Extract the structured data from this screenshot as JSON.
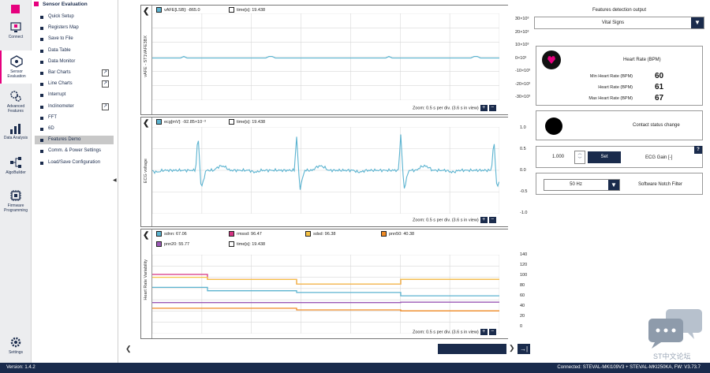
{
  "sidebar": {
    "items": [
      {
        "label": "Connect",
        "icon": "connect-icon"
      },
      {
        "label": "Sensor Evaluation",
        "icon": "sensor-evaluation-icon",
        "active": true
      },
      {
        "label": "Advanced Features",
        "icon": "advanced-features-icon"
      },
      {
        "label": "Data Analysis",
        "icon": "data-analysis-icon"
      },
      {
        "label": "AlgoBuilder",
        "icon": "algobuilder-icon"
      },
      {
        "label": "Firmware Programming",
        "icon": "firmware-programming-icon"
      },
      {
        "label": "Settings",
        "icon": "settings-icon"
      }
    ]
  },
  "menu": {
    "title": "Sensor Evaluation",
    "items": [
      {
        "label": "Quick Setup"
      },
      {
        "label": "Registers Map"
      },
      {
        "label": "Save to File"
      },
      {
        "label": "Data Table"
      },
      {
        "label": "Data Monitor"
      },
      {
        "label": "Bar Charts",
        "external": true
      },
      {
        "label": "Line Charts",
        "external": true
      },
      {
        "label": "Interrupt"
      },
      {
        "label": "Inclinometer",
        "external": true
      },
      {
        "label": "FFT"
      },
      {
        "label": "6D"
      },
      {
        "label": "Features Demo",
        "active": true
      },
      {
        "label": "Comm. & Power Settings"
      },
      {
        "label": "Load/Save Configuration"
      }
    ]
  },
  "charts": {
    "vafe": {
      "ylabel": "vAFE - ST1VAFE3BX",
      "legend": [
        {
          "label": "vAFE[LSB]: -865.0",
          "color": "#5bb3d0",
          "filled": true
        },
        {
          "label": "time[s]: 19.438",
          "color": "#ffffff",
          "filled": false
        }
      ],
      "zoom": "Zoom: 0.5 s per div. (3.6 s in view)",
      "ticks": [
        "30×10³",
        "20×10³",
        "10×10³",
        "0×10³",
        "-10×10³",
        "-20×10³",
        "-30×10³"
      ]
    },
    "ecg": {
      "ylabel": "ECG voltage",
      "legend": [
        {
          "label": "ecg[mV]: -92.85×10⁻³",
          "color": "#5bb3d0",
          "filled": true
        },
        {
          "label": "time[s]: 19.438",
          "color": "#ffffff",
          "filled": false
        }
      ],
      "zoom": "Zoom: 0.5 s per div. (3.6 s in view)",
      "ticks": [
        "1.0",
        "0.5",
        "0.0",
        "-0.5",
        "-1.0"
      ]
    },
    "hrv": {
      "ylabel": "Heart Rate Variability",
      "legend": [
        {
          "label": "sdnn: 67.06",
          "color": "#5bb3d0"
        },
        {
          "label": "rmssd: 96.47",
          "color": "#d63384"
        },
        {
          "label": "sdsd: 96.38",
          "color": "#f6c244"
        },
        {
          "label": "pnn50: 40.38",
          "color": "#f08a24"
        },
        {
          "label": "pnn20: 55.77",
          "color": "#9b59b6"
        },
        {
          "label": "time[s]: 19.438",
          "color": "#ffffff"
        }
      ],
      "zoom": "Zoom: 0.5 s per div. (3.6 s in view)",
      "ticks": [
        "140",
        "120",
        "100",
        "80",
        "60",
        "40",
        "20",
        "0"
      ]
    }
  },
  "chart_data": [
    {
      "type": "line",
      "title": "",
      "ylabel": "vAFE - ST1VAFE3BX",
      "ylim": [
        -30000,
        30000
      ],
      "series": [
        {
          "name": "vAFE[LSB]",
          "values": [
            -865,
            -865,
            -865,
            -865,
            -865
          ]
        }
      ]
    },
    {
      "type": "line",
      "title": "",
      "ylabel": "ECG voltage",
      "ylim": [
        -1.0,
        1.0
      ],
      "series": [
        {
          "name": "ecg[mV]",
          "values": [
            0.0,
            0.02,
            0.85,
            -0.45,
            0.05,
            0.0,
            0.78,
            -0.4,
            0.05,
            0.0,
            0.82,
            -0.5,
            0.05,
            0.0,
            0.72,
            -0.45
          ]
        }
      ]
    },
    {
      "type": "line",
      "title": "",
      "ylabel": "Heart Rate Variability",
      "ylim": [
        0,
        140
      ],
      "x": [
        0,
        1,
        2,
        3
      ],
      "series": [
        {
          "name": "sdnn",
          "values": [
            82,
            76,
            73,
            67.06
          ]
        },
        {
          "name": "rmssd",
          "values": [
            105,
            96,
            88,
            96.47
          ]
        },
        {
          "name": "sdsd",
          "values": [
            100,
            96,
            88,
            96.38
          ]
        },
        {
          "name": "pnn50",
          "values": [
            45,
            45,
            42,
            40.38
          ]
        },
        {
          "name": "pnn20",
          "values": [
            55,
            55,
            55,
            55.77
          ]
        }
      ]
    }
  ],
  "features": {
    "title": "Features detection output",
    "selected": "Vital Signs",
    "heart_rate": {
      "title": "Heart Rate (BPM)",
      "rows": [
        {
          "label": "Min Heart Rate (BPM)",
          "value": "60"
        },
        {
          "label": "Heart Rate (BPM)",
          "value": "61"
        },
        {
          "label": "Max Heart Rate (BPM)",
          "value": "67"
        }
      ]
    },
    "contact": {
      "label": "Contact status change"
    },
    "gain": {
      "value": "1.000",
      "set_label": "Set",
      "label": "ECG Gain [-]",
      "help": "?"
    },
    "notch": {
      "selected": "50 Hz",
      "label": "Software Notch Filter"
    }
  },
  "status": {
    "version": "Version: 1.4.2",
    "connection": "Connected:  STEVAL-MKI109V3 + STEVAL-MKI250KA, FW: V3.73.7"
  },
  "watermark": "ST中文论坛"
}
